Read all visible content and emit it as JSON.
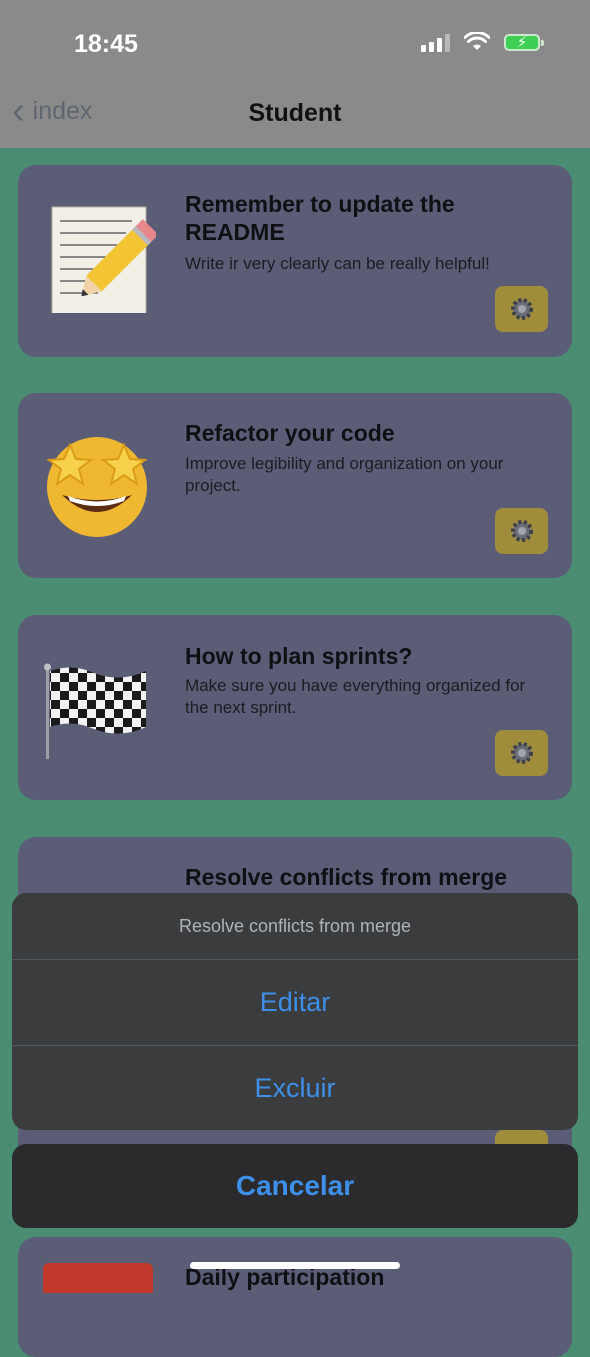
{
  "status_bar": {
    "time": "18:45"
  },
  "nav": {
    "back_label": "index",
    "title": "Student"
  },
  "cards": [
    {
      "title": "Remember to update the README",
      "description": "Write ir very clearly can be really helpful!",
      "emoji": "memo-pencil-icon"
    },
    {
      "title": "Refactor your code",
      "description": "Improve legibility and organization on your project.",
      "emoji": "star-struck-icon"
    },
    {
      "title": "How to plan sprints?",
      "description": "Make sure you have everything organized for the next sprint.",
      "emoji": "checkered-flag-icon"
    },
    {
      "title": "Resolve conflicts from merge",
      "description": "",
      "emoji": ""
    },
    {
      "title": "Daily participation",
      "description": "",
      "emoji": "calendar-icon"
    }
  ],
  "action_sheet": {
    "title": "Resolve conflicts from merge",
    "edit_label": "Editar",
    "delete_label": "Excluir",
    "cancel_label": "Cancelar"
  },
  "colors": {
    "background": "#4a8d73",
    "card": "#5b5d77",
    "gear_button": "#9f8d3c",
    "action_blue": "#3d8fe8"
  }
}
